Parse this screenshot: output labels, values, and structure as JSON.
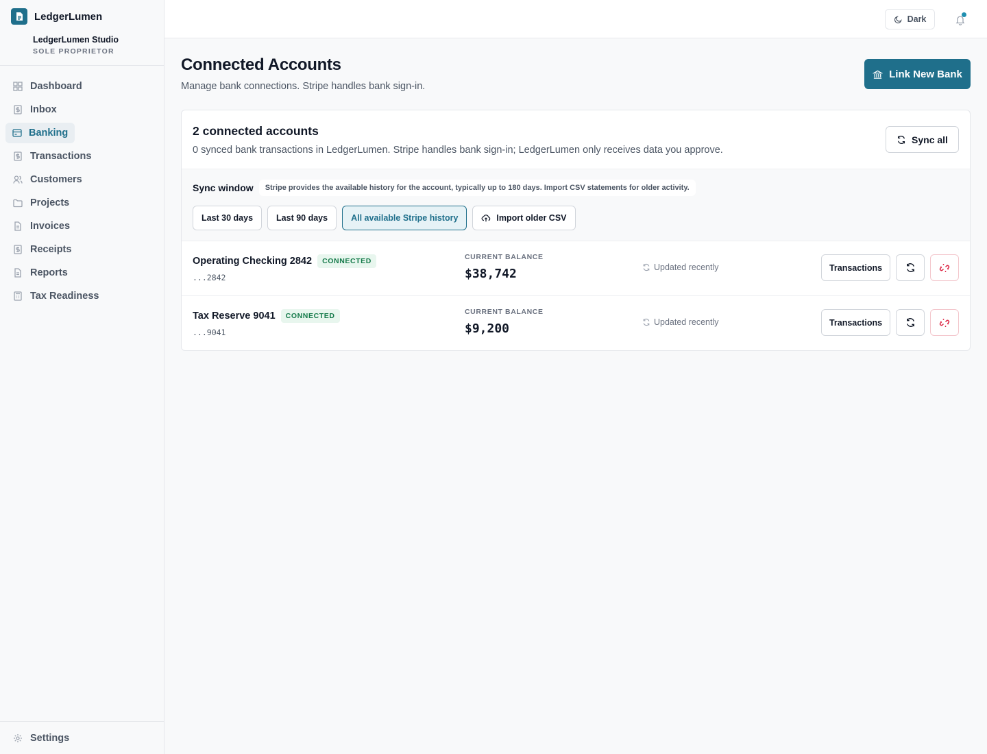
{
  "brand": {
    "name": "LedgerLumen",
    "org_name": "LedgerLumen Studio",
    "org_type": "SOLE PROPRIETOR",
    "accent": "#1f6f8b"
  },
  "sidebar": {
    "items": [
      {
        "label": "Dashboard",
        "icon": "dashboard-icon"
      },
      {
        "label": "Inbox",
        "icon": "inbox-icon"
      },
      {
        "label": "Banking",
        "icon": "bank-card-icon",
        "active": true
      },
      {
        "label": "Transactions",
        "icon": "dollar-doc-icon"
      },
      {
        "label": "Customers",
        "icon": "users-icon"
      },
      {
        "label": "Projects",
        "icon": "folder-icon"
      },
      {
        "label": "Invoices",
        "icon": "document-icon"
      },
      {
        "label": "Receipts",
        "icon": "receipt-icon"
      },
      {
        "label": "Reports",
        "icon": "report-icon"
      },
      {
        "label": "Tax Readiness",
        "icon": "calculator-icon"
      }
    ],
    "settings_label": "Settings"
  },
  "topbar": {
    "theme_label": "Dark",
    "notification_dot_color": "#1f8fb0"
  },
  "page": {
    "title": "Connected Accounts",
    "subtitle": "Manage bank connections. Stripe handles bank sign-in.",
    "link_bank_label": "Link New Bank"
  },
  "summary": {
    "title": "2 connected accounts",
    "subtitle": "0 synced bank transactions in LedgerLumen. Stripe handles bank sign-in; LedgerLumen only receives data you approve.",
    "sync_all_label": "Sync all"
  },
  "sync_window": {
    "label": "Sync window",
    "hint": "Stripe provides the available history for the account, typically up to 180 days. Import CSV statements for older activity.",
    "options": [
      {
        "label": "Last 30 days"
      },
      {
        "label": "Last 90 days"
      },
      {
        "label": "All available Stripe history",
        "selected": true
      },
      {
        "label": "Import older CSV",
        "icon": "upload-cloud-icon"
      }
    ]
  },
  "accounts": [
    {
      "name": "Operating Checking 2842",
      "status": "CONNECTED",
      "mask": "...2842",
      "balance_label": "CURRENT BALANCE",
      "balance": "$38,742",
      "updated": "Updated recently",
      "transactions_label": "Transactions"
    },
    {
      "name": "Tax Reserve 9041",
      "status": "CONNECTED",
      "mask": "...9041",
      "balance_label": "CURRENT BALANCE",
      "balance": "$9,200",
      "updated": "Updated recently",
      "transactions_label": "Transactions"
    }
  ]
}
